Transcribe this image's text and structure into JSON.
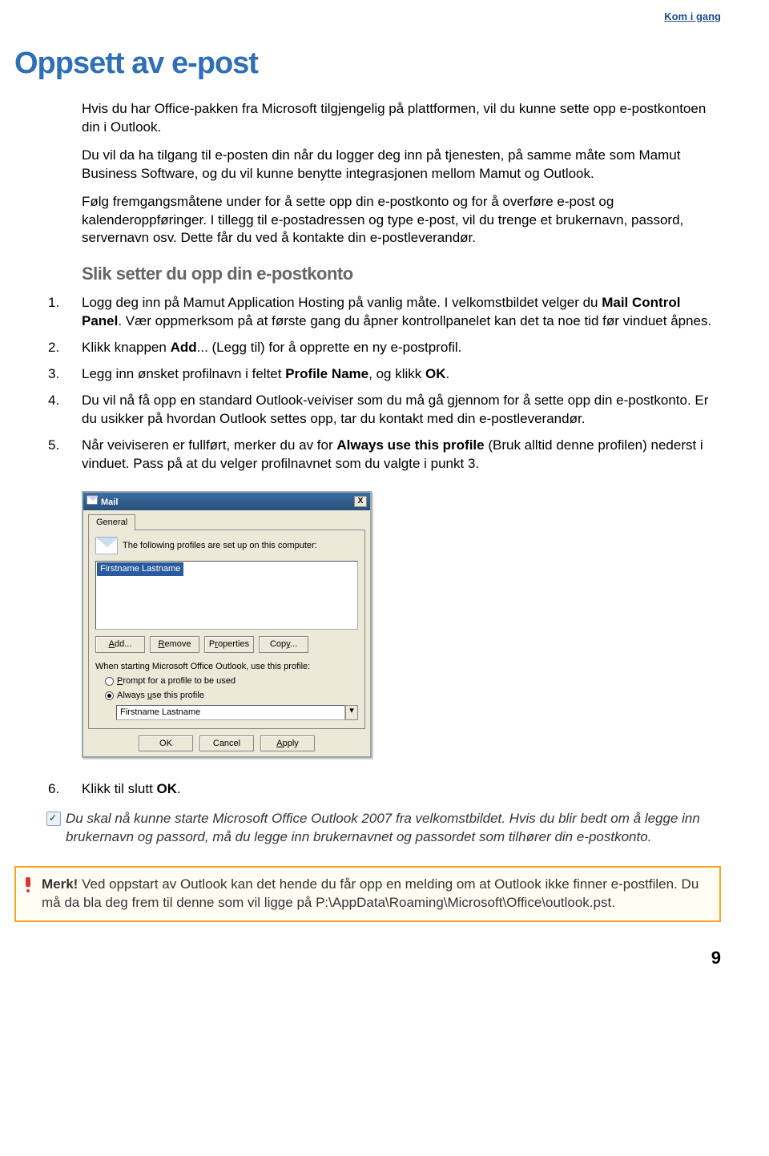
{
  "header_link": "Kom i gang",
  "h1": "Oppsett av e-post",
  "intro": [
    "Hvis du har Office-pakken fra Microsoft tilgjengelig på plattformen, vil du kunne sette opp e-postkontoen din i Outlook.",
    "Du vil da ha tilgang til e-posten din når du logger deg inn på tjenesten, på samme måte som Mamut Business Software, og du vil kunne benytte integrasjonen mellom Mamut og Outlook.",
    "Følg fremgangsmåtene under for å sette opp din e-postkonto og for å overføre e-post og kalenderoppføringer. I tillegg til e-postadressen og type e-post, vil du trenge et brukernavn, passord, servernavn osv. Dette får du ved å kontakte din e-postleverandør."
  ],
  "h2": "Slik setter du opp din e-postkonto",
  "steps": [
    {
      "n": "1.",
      "txt_a": "Logg deg inn på Mamut Application Hosting på vanlig måte. I velkomstbildet velger du ",
      "b1": "Mail Control Panel",
      "txt_b": ". Vær oppmerksom på at første gang du åpner kontrollpanelet kan det ta noe tid før vinduet åpnes."
    },
    {
      "n": "2.",
      "txt_a": "Klikk knappen ",
      "b1": "Add",
      "txt_b": "... (Legg til) for å opprette en ny e-postprofil."
    },
    {
      "n": "3.",
      "txt_a": "Legg inn ønsket profilnavn i feltet ",
      "b1": "Profile Name",
      "txt_b": ", og klikk ",
      "b2": "OK",
      "txt_c": "."
    },
    {
      "n": "4.",
      "txt_a": "Du vil nå få opp en standard Outlook-veiviser som du må gå gjennom for å sette opp din e-postkonto. Er du usikker på hvordan Outlook settes opp, tar du kontakt med din e-postleverandør."
    },
    {
      "n": "5.",
      "txt_a": "Når veiviseren er fullført, merker du av for ",
      "b1": "Always use this profile",
      "txt_b": " (Bruk alltid denne profilen) nederst i vinduet. Pass på at du velger profilnavnet som du valgte i punkt 3."
    }
  ],
  "step6": {
    "n": "6.",
    "txt_a": "Klikk til slutt ",
    "b1": "OK",
    "txt_b": "."
  },
  "tip": "Du skal nå kunne starte Microsoft Office Outlook 2007 fra velkomstbildet. Hvis du blir bedt om å legge inn brukernavn og passord, må du legge inn brukernavnet og passordet som tilhører din e-postkonto.",
  "warn_lead": "Merk!",
  "warn_text": " Ved oppstart av Outlook kan det hende du får opp en melding om at Outlook ikke finner e-postfilen. Du må da bla deg frem til denne som vil ligge på P:\\AppData\\Roaming\\Microsoft\\Office\\outlook.pst.",
  "page_num": "9",
  "dialog": {
    "title": "Mail",
    "close": "X",
    "tab": "General",
    "heading": "The following profiles are set up on this computer:",
    "profile_item": "Firstname Lastname",
    "btn_add": "Add...",
    "btn_remove": "Remove",
    "btn_props": "Properties",
    "btn_copy": "Copy...",
    "starting_text": "When starting Microsoft Office Outlook, use this profile:",
    "radio_prompt": "Prompt for a profile to be used",
    "radio_always": "Always use this profile",
    "selected_profile": "Firstname Lastname",
    "btn_ok": "OK",
    "btn_cancel": "Cancel",
    "btn_apply": "Apply"
  }
}
